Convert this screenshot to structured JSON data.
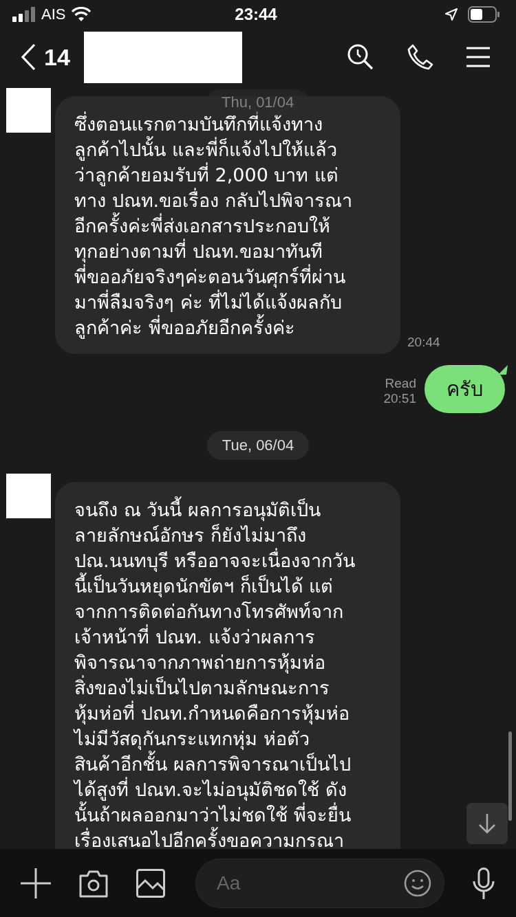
{
  "status_bar": {
    "carrier": "AIS",
    "time": "23:44"
  },
  "header": {
    "unread_count": "14"
  },
  "sticky_date": "Thu, 01/04",
  "messages": [
    {
      "kind": "incoming",
      "text": "ซึ่งตอนแรกตามบันทึกที่แจ้งทาง\nลูกค้าไปนั้น และพี่ก็แจ้งไปให้แล้ว\nว่าลูกค้ายอมรับที่ 2,000 บาท แต่\nทาง ปณท.ขอเรื่อง กลับไปพิจารณา\nอีกครั้งค่ะพี่ส่งเอกสารประกอบให้\nทุกอย่างตามที่ ปณท.ขอมาทันที\nพี่ขออภัยจริงๆค่ะตอนวันศุกร์ที่ผ่าน\nมาพี่ลืมจริงๆ ค่ะ ที่ไม่ได้แจ้งผลกับ\nลูกค้าค่ะ พี่ขออภัยอีกครั้งค่ะ",
      "time": "20:44"
    },
    {
      "kind": "outgoing",
      "text": "ครับ",
      "status": "Read",
      "time": "20:51"
    },
    {
      "kind": "date",
      "text": "Tue, 06/04"
    },
    {
      "kind": "incoming",
      "text": "จนถึง ณ วันนี้ ผลการอนุมัติเป็น\nลายลักษณ์อักษร ก็ยังไม่มาถึง\nปณ.นนทบุรี หรืออาจจะเนื่องจากวัน\nนี้เป็นวันหยุดนักขัตฯ ก็เป็นได้ แต่\nจากการติดต่อกันทางโทรศัพท์จาก\nเจ้าหน้าที่ ปณท. แจ้งว่าผลการ\nพิจารณาจากภาพถ่ายการหุ้มห่อ\nสิ่งของไม่เป็นไปตามลักษณะการ\nหุ้มห่อที่ ปณท.กำหนดคือการหุ้มห่อ\nไม่มีวัสดุกันกระแทกหุ่ม ห่อตัว\nสินค้าอีกชั้น ผลการพิจารณาเป็นไป\nได้สูงที่ ปณท.จะไม่อนุมัติชดใช้ ดัง\nนั้นถ้าผลออกมาว่าไม่ชดใช้ พี่จะยื่น\nเรื่องเสนอไปอีกครั้งขอความกรณา"
    }
  ],
  "composer": {
    "placeholder": "Aa"
  }
}
